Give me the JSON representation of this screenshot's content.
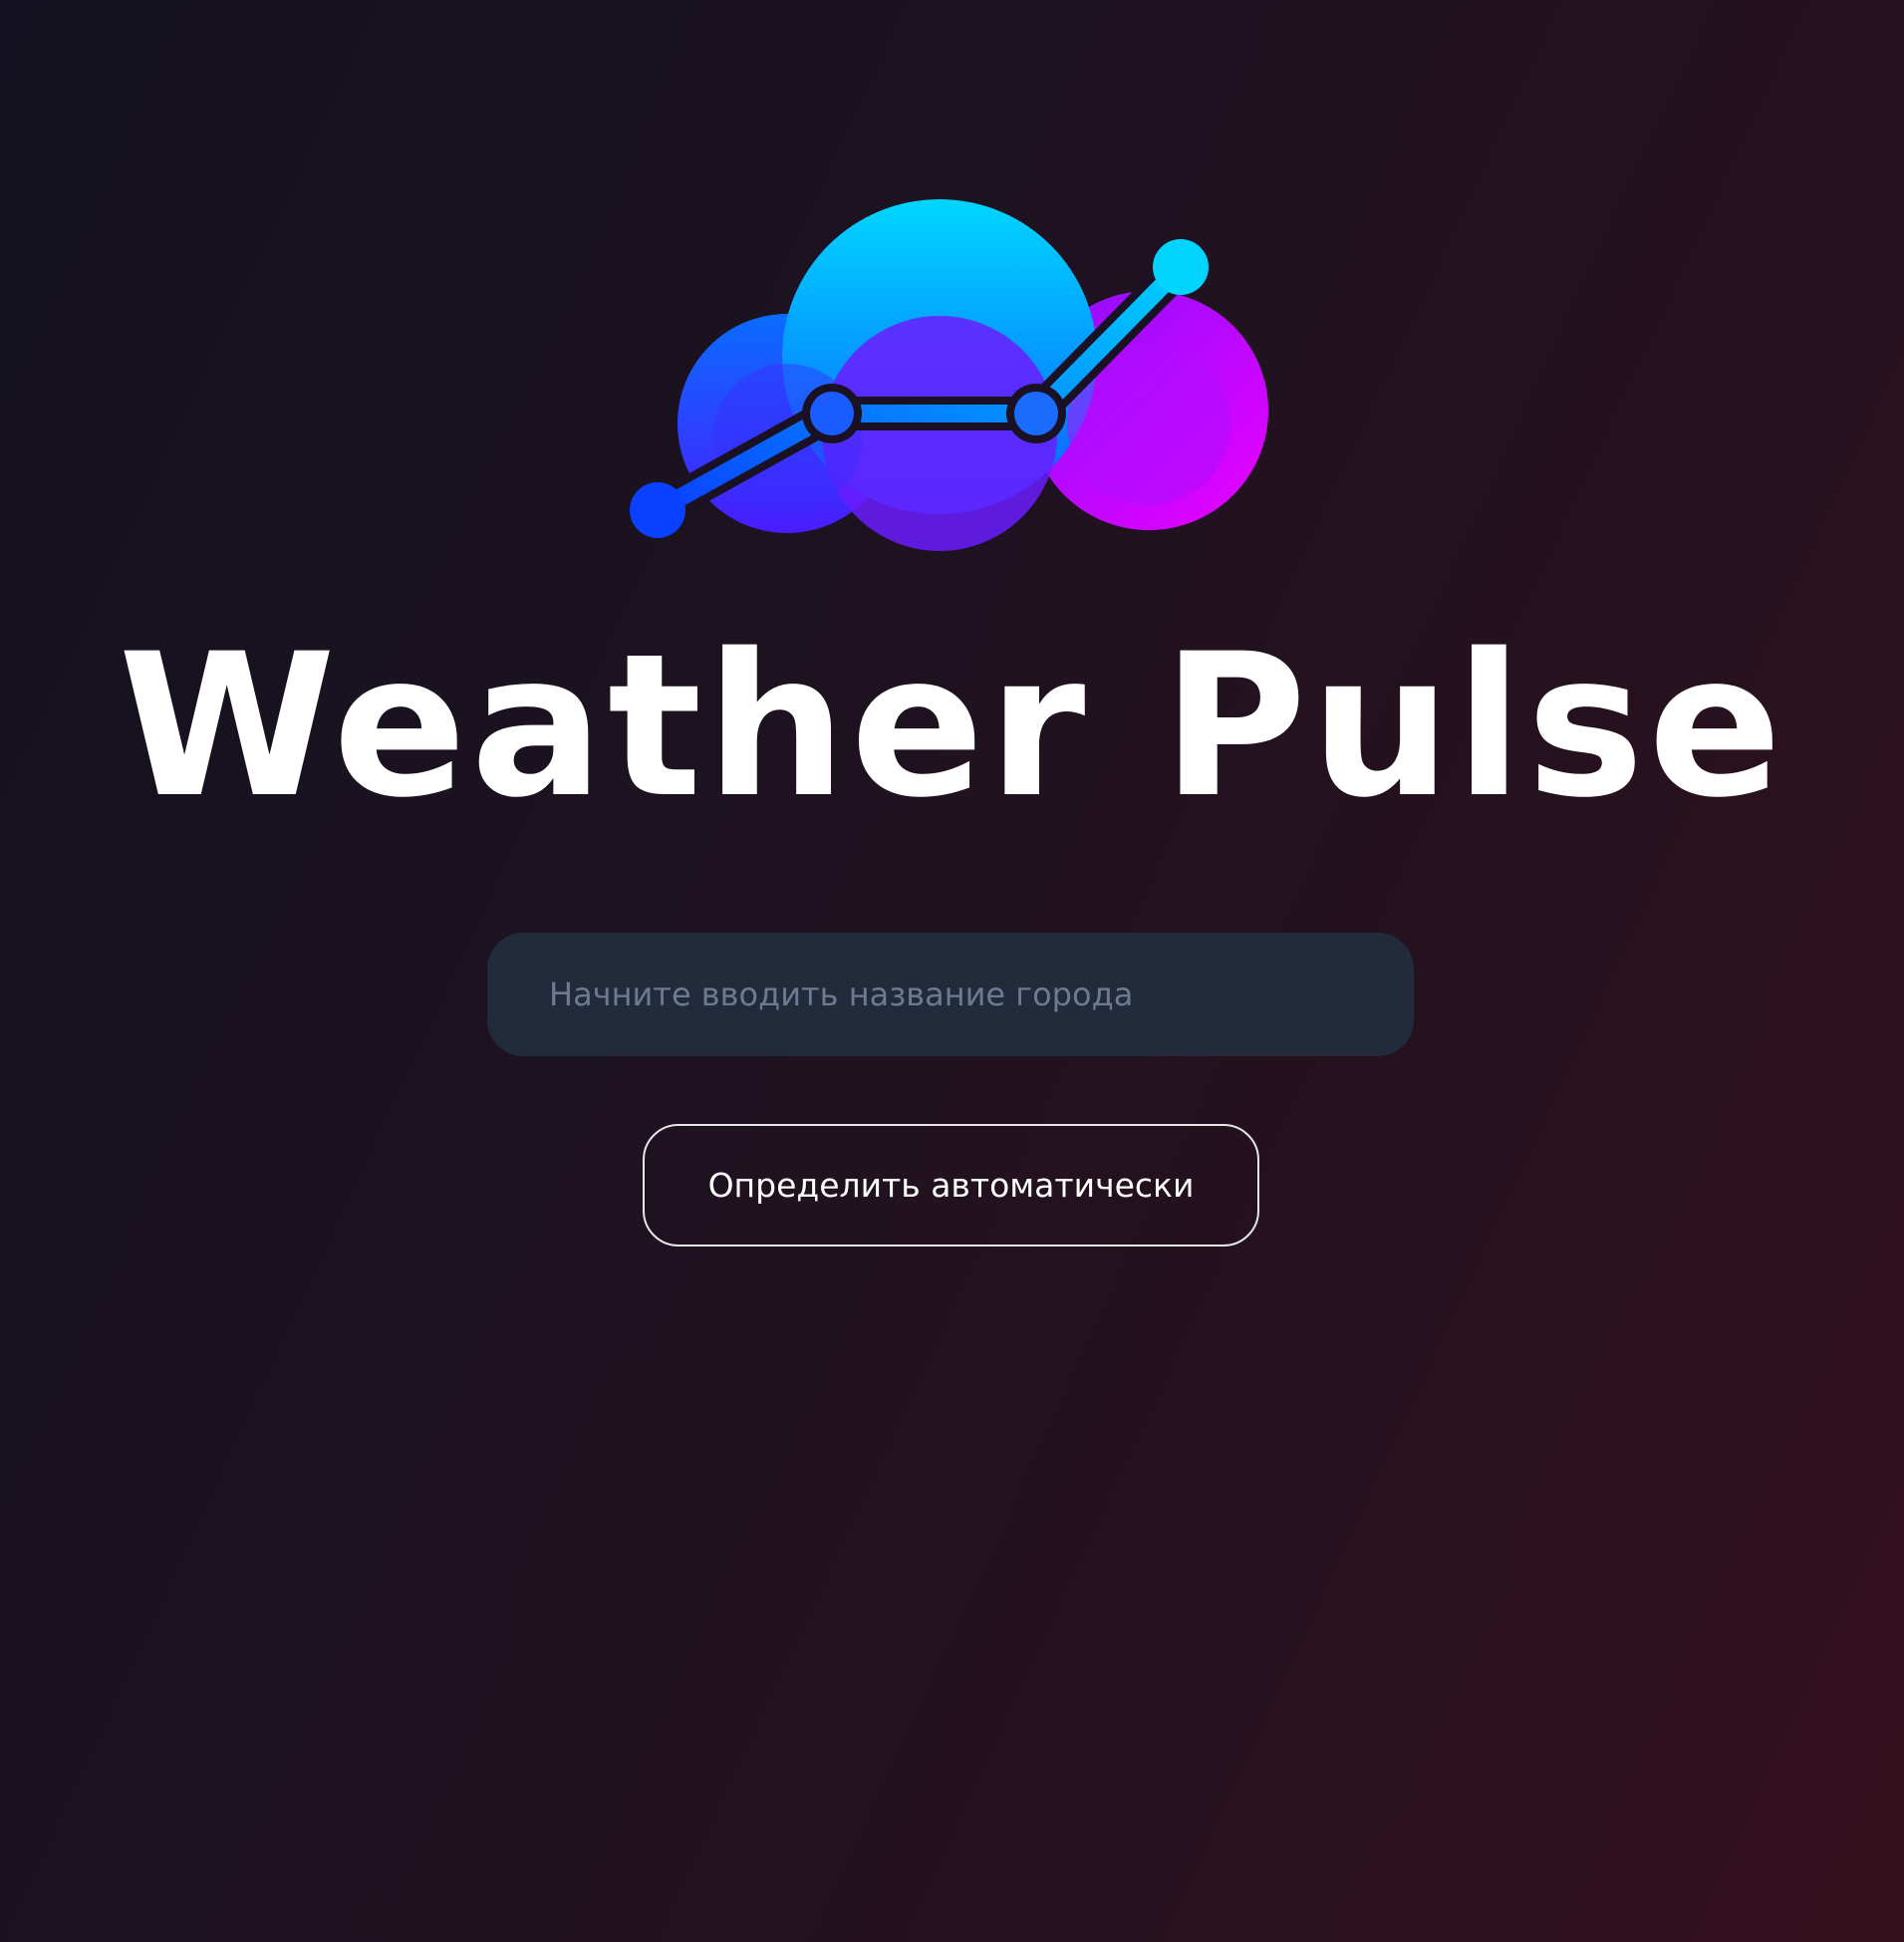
{
  "app": {
    "title": "Weather Pulse"
  },
  "logo": {
    "icon": "cloud-chart-logo",
    "colors": {
      "cyan": "#00d6ff",
      "blue": "#0a5cff",
      "violet": "#7a1cff",
      "magenta": "#e600ff"
    }
  },
  "search": {
    "placeholder": "Начните вводить название города",
    "value": ""
  },
  "actions": {
    "auto_detect_label": "Определить автоматически"
  },
  "theme": {
    "background_start": "#13111f",
    "background_end": "#35101d",
    "input_background": "#212b3b",
    "placeholder_color": "#6e7a92"
  }
}
